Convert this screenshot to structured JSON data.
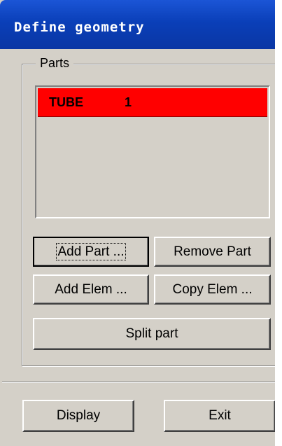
{
  "window": {
    "title": "Define geometry"
  },
  "parts_group": {
    "legend": "Parts",
    "list": [
      {
        "name": "TUBE",
        "id": "1",
        "selected": true
      }
    ],
    "buttons": {
      "add_part": "Add Part ...",
      "remove_part": "Remove Part",
      "add_elem": "Add Elem ...",
      "copy_elem": "Copy Elem ...",
      "split_part": "Split part"
    }
  },
  "footer": {
    "display": "Display",
    "exit": "Exit"
  },
  "colors": {
    "titlebar": "#0a3fb8",
    "window_bg": "#d4d0c8",
    "selected_row": "#ff0000"
  }
}
